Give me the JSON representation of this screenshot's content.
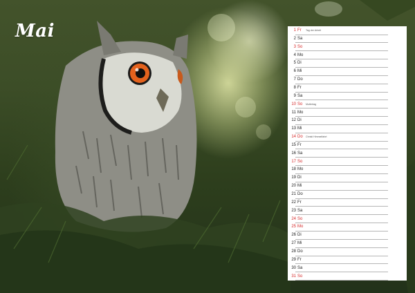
{
  "calendar": {
    "month": "Mai",
    "days": [
      {
        "num": "1",
        "day": "Fr",
        "note": "Tag der Arbeit",
        "red": true
      },
      {
        "num": "2",
        "day": "Sa",
        "note": "",
        "red": false
      },
      {
        "num": "3",
        "day": "So",
        "note": "",
        "red": true
      },
      {
        "num": "4",
        "day": "Mo",
        "note": "",
        "red": false
      },
      {
        "num": "5",
        "day": "Di",
        "note": "",
        "red": false
      },
      {
        "num": "6",
        "day": "Mi",
        "note": "",
        "red": false
      },
      {
        "num": "7",
        "day": "Do",
        "note": "",
        "red": false
      },
      {
        "num": "8",
        "day": "Fr",
        "note": "",
        "red": false
      },
      {
        "num": "9",
        "day": "Sa",
        "note": "",
        "red": false
      },
      {
        "num": "10",
        "day": "So",
        "note": "Muttertag",
        "red": true
      },
      {
        "num": "11",
        "day": "Mo",
        "note": "",
        "red": false
      },
      {
        "num": "12",
        "day": "Di",
        "note": "",
        "red": false
      },
      {
        "num": "13",
        "day": "Mi",
        "note": "",
        "red": false
      },
      {
        "num": "14",
        "day": "Do",
        "note": "Christi Himmelfahrt",
        "red": true
      },
      {
        "num": "15",
        "day": "Fr",
        "note": "",
        "red": false
      },
      {
        "num": "16",
        "day": "Sa",
        "note": "",
        "red": false
      },
      {
        "num": "17",
        "day": "So",
        "note": "",
        "red": true
      },
      {
        "num": "18",
        "day": "Mo",
        "note": "",
        "red": false
      },
      {
        "num": "19",
        "day": "Di",
        "note": "",
        "red": false
      },
      {
        "num": "20",
        "day": "Mi",
        "note": "",
        "red": false
      },
      {
        "num": "21",
        "day": "Do",
        "note": "",
        "red": false
      },
      {
        "num": "22",
        "day": "Fr",
        "note": "",
        "red": false
      },
      {
        "num": "23",
        "day": "Sa",
        "note": "",
        "red": false
      },
      {
        "num": "24",
        "day": "So",
        "note": "",
        "red": true
      },
      {
        "num": "25",
        "day": "Mo",
        "note": "",
        "red": true
      },
      {
        "num": "26",
        "day": "Di",
        "note": "",
        "red": false
      },
      {
        "num": "27",
        "day": "Mi",
        "note": "",
        "red": false
      },
      {
        "num": "28",
        "day": "Do",
        "note": "",
        "red": false
      },
      {
        "num": "29",
        "day": "Fr",
        "note": "",
        "red": false
      },
      {
        "num": "30",
        "day": "Sa",
        "note": "",
        "red": false
      },
      {
        "num": "31",
        "day": "So",
        "note": "",
        "red": true
      }
    ]
  },
  "colors": {
    "holiday": "#d62a2a",
    "text": "#222222",
    "panel": "#ffffff"
  }
}
